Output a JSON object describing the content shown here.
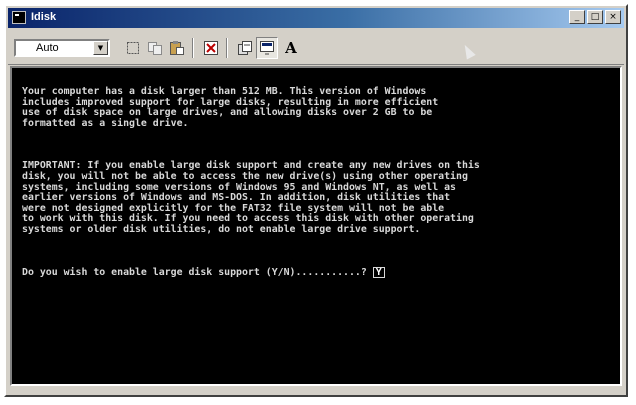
{
  "window": {
    "title": "Idisk",
    "controls": [
      "_",
      "□",
      "×"
    ]
  },
  "toolbar": {
    "font_size_value": "Auto",
    "tools": [
      {
        "name": "mark-icon"
      },
      {
        "name": "copy-icon"
      },
      {
        "name": "paste-icon"
      },
      {
        "name": "fullscreen-icon"
      },
      {
        "name": "properties-icon"
      },
      {
        "name": "background-icon"
      },
      {
        "name": "font-icon",
        "glyph": "A"
      }
    ]
  },
  "console": {
    "paragraph1": [
      "Your computer has a disk larger than 512 MB. This version of Windows",
      "includes improved support for large disks, resulting in more efficient",
      "use of disk space on large drives, and allowing disks over 2 GB to be",
      "formatted as a single drive."
    ],
    "paragraph2": [
      "IMPORTANT: If you enable large disk support and create any new drives on this",
      "disk, you will not be able to access the new drive(s) using other operating",
      "systems, including some versions of Windows 95 and Windows NT, as well as",
      "earlier versions of Windows and MS-DOS. In addition, disk utilities that",
      "were not designed explicitly for the FAT32 file system will not be able",
      "to work with this disk. If you need to access this disk with other operating",
      "systems or older disk utilities, do not enable large drive support."
    ],
    "prompt": "Do you wish to enable large disk support (Y/N)...........?",
    "answer": "Y"
  },
  "colors": {
    "console_bg": "#000000",
    "console_fg": "#d8d8d8",
    "title_gradient_start": "#0a246a",
    "title_gradient_end": "#a6caf0",
    "chrome": "#d4d0c8"
  }
}
